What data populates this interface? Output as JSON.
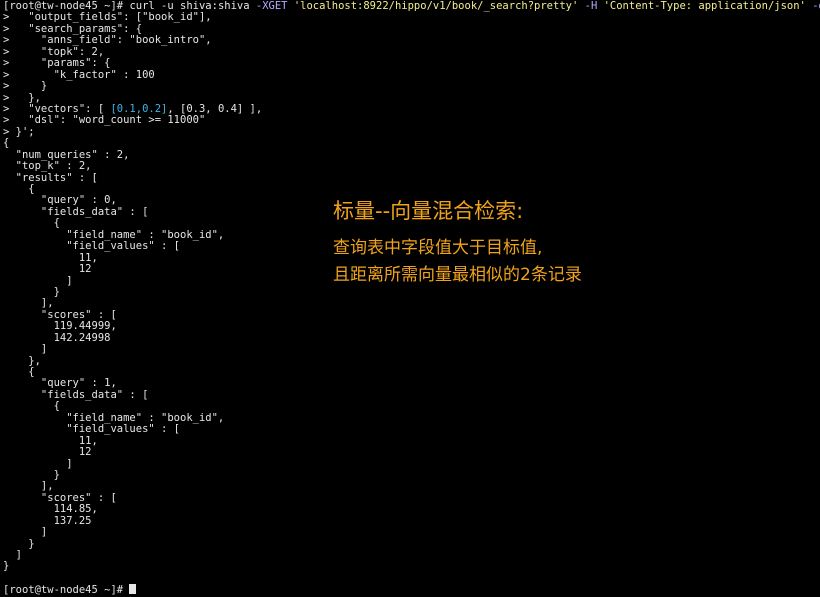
{
  "terminal": {
    "prompt": "[root@tw-node45 ~]# ",
    "command": {
      "pre": "curl -u shiva:shiva ",
      "flag_xget": "-XGET ",
      "url": "'localhost:8922/hippo/v1/book/_search?pretty'",
      "space1": " ",
      "flag_h": "-H ",
      "header": "'Content-Type: application/json'",
      "space2": " ",
      "flag_d": "-d",
      "tail": "'{"
    },
    "lines": [
      ">   \"output_fields\": [\"book_id\"],",
      ">   \"search_params\": {",
      ">     \"anns_field\": \"book_intro\",",
      ">     \"topk\": 2,",
      ">     \"params\": {",
      ">       \"k_factor\" : 100",
      ">     }",
      ">   },",
      ">   \"vectors\": [ [0.1,0.2], [0.3, 0.4] ],",
      ">   \"dsl\": \"word_count >= 11000\"",
      "> }';",
      "{",
      "  \"num_queries\" : 2,",
      "  \"top_k\" : 2,",
      "  \"results\" : [",
      "    {",
      "      \"query\" : 0,",
      "      \"fields_data\" : [",
      "        {",
      "          \"field_name\" : \"book_id\",",
      "          \"field_values\" : [",
      "            11,",
      "            12",
      "          ]",
      "        }",
      "      ],",
      "      \"scores\" : [",
      "        119.44999,",
      "        142.24998",
      "      ]",
      "    },",
      "    {",
      "      \"query\" : 1,",
      "      \"fields_data\" : [",
      "        {",
      "          \"field_name\" : \"book_id\",",
      "          \"field_values\" : [",
      "            11,",
      "            12",
      "          ]",
      "        }",
      "      ],",
      "      \"scores\" : [",
      "        114.85,",
      "        137.25",
      "      ]",
      "    }",
      "  ]",
      "}"
    ],
    "vectors_line": {
      "pre": ">   \"vectors\": [ ",
      "highlight": "[0.1,0.2]",
      "post": ", [0.3, 0.4] ],"
    },
    "final_prompt": "[root@tw-node45 ~]# "
  },
  "annotation": {
    "title": "标量--向量混合检索:",
    "lines": [
      "查询表中字段值大于目标值,",
      "且距离所需向量最相似的2条记录"
    ]
  },
  "colors": {
    "background": "#000000",
    "text": "#e6e6e6",
    "url": "#f3ee8e",
    "flag": "#b8a9ff",
    "highlight_vector": "#3fb3e6",
    "annotation": "#f0a31a"
  }
}
